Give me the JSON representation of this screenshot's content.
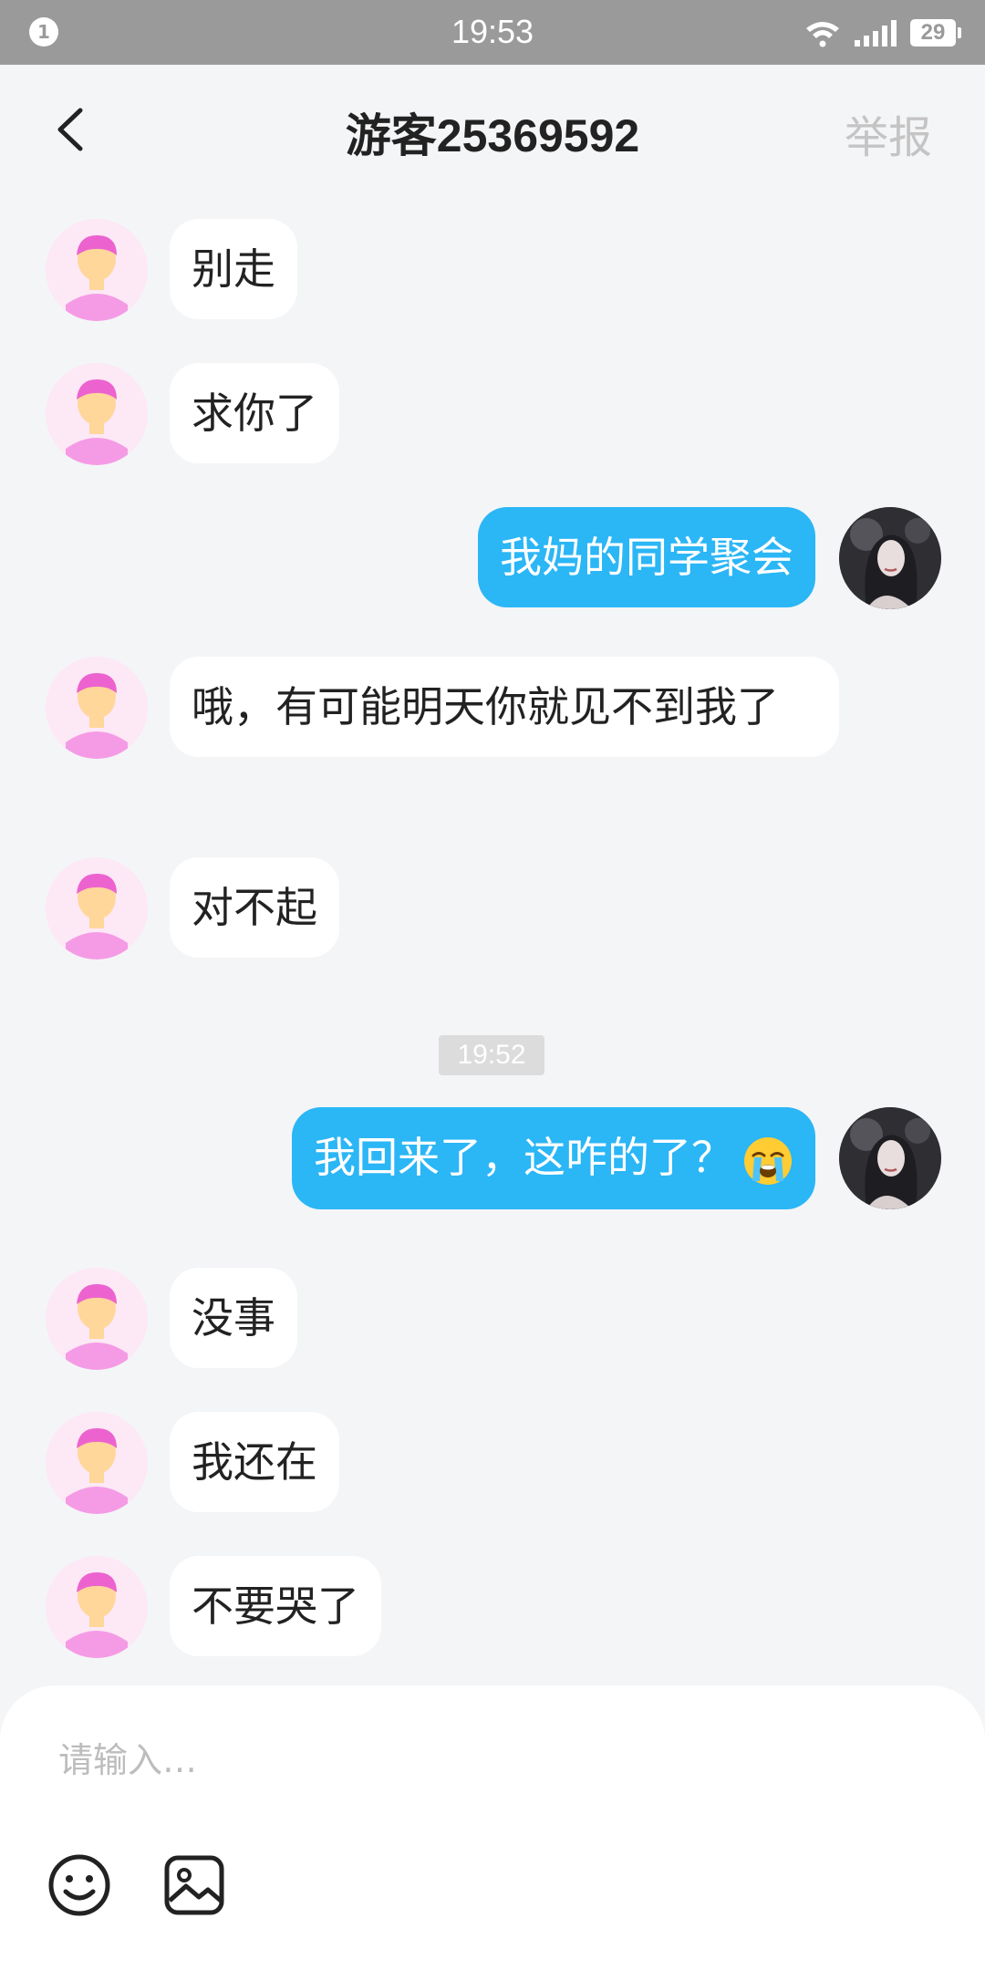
{
  "status_bar": {
    "notification_count": "1",
    "time": "19:53",
    "battery": "29",
    "icons": [
      "wifi-icon",
      "signal-icon",
      "battery-icon"
    ]
  },
  "header": {
    "title": "游客25369592",
    "report_label": "举报",
    "back_icon": "chevron-left-icon"
  },
  "messages": [
    {
      "side": "in",
      "text": "别走"
    },
    {
      "side": "in",
      "text": "求你了"
    },
    {
      "side": "out",
      "text": "我妈的同学聚会"
    },
    {
      "side": "in",
      "text": "哦，有可能明天你就见不到我了"
    },
    {
      "side": "in",
      "text": "对不起"
    },
    {
      "type": "timestamp",
      "text": "19:52"
    },
    {
      "side": "out",
      "text": "我回来了，这咋的了？",
      "emoji": "loudly-crying-face"
    },
    {
      "side": "in",
      "text": "没事"
    },
    {
      "side": "in",
      "text": "我还在"
    },
    {
      "side": "in",
      "text": "不要哭了"
    }
  ],
  "composer": {
    "placeholder": "请输入…",
    "tools": [
      "smiley-icon",
      "image-icon"
    ]
  },
  "colors": {
    "outgoing_bubble": "#2bb6f6",
    "incoming_bubble": "#ffffff",
    "background": "#f4f5f7",
    "status_bar": "#9a9a9a"
  }
}
